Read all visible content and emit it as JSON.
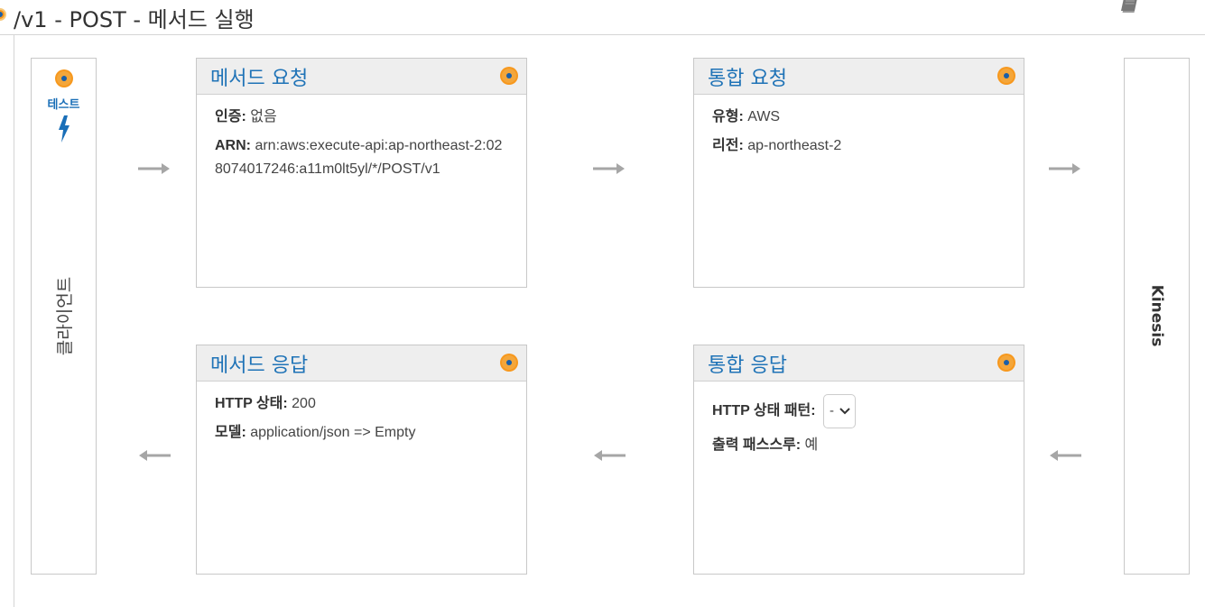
{
  "page": {
    "title": "/v1 - POST - 메서드 실행"
  },
  "client": {
    "test_label": "테스트",
    "name": "클라이언트"
  },
  "kinesis": {
    "name": "Kinesis"
  },
  "method_request": {
    "title": "메서드 요청",
    "auth_label": "인증:",
    "auth_value": "없음",
    "arn_label": "ARN:",
    "arn_value": "arn:aws:execute-api:ap-northeast-2:028074017246:a11m0lt5yl/*/POST/v1"
  },
  "integration_request": {
    "title": "통합 요청",
    "type_label": "유형:",
    "type_value": "AWS",
    "region_label": "리전:",
    "region_value": "ap-northeast-2"
  },
  "method_response": {
    "title": "메서드 응답",
    "status_label": "HTTP 상태:",
    "status_value": "200",
    "model_label": "모델:",
    "model_value": "application/json => Empty"
  },
  "integration_response": {
    "title": "통합 응답",
    "pattern_label": "HTTP 상태 패턴:",
    "pattern_value": "-",
    "passthrough_label": "출력 패스스루:",
    "passthrough_value": "예"
  },
  "icons": {
    "status_dot": "orange-circle-icon",
    "bolt": "lightning-bolt-icon",
    "book": "book-icon",
    "arrow_right": "arrow-right-icon",
    "arrow_left": "arrow-left-icon",
    "chevron": "chevron-down-icon"
  },
  "colors": {
    "link_blue": "#1f73b7",
    "accent_orange": "#f7981d",
    "arrow_gray": "#a6a6a6",
    "header_gray": "#eeeeee"
  }
}
